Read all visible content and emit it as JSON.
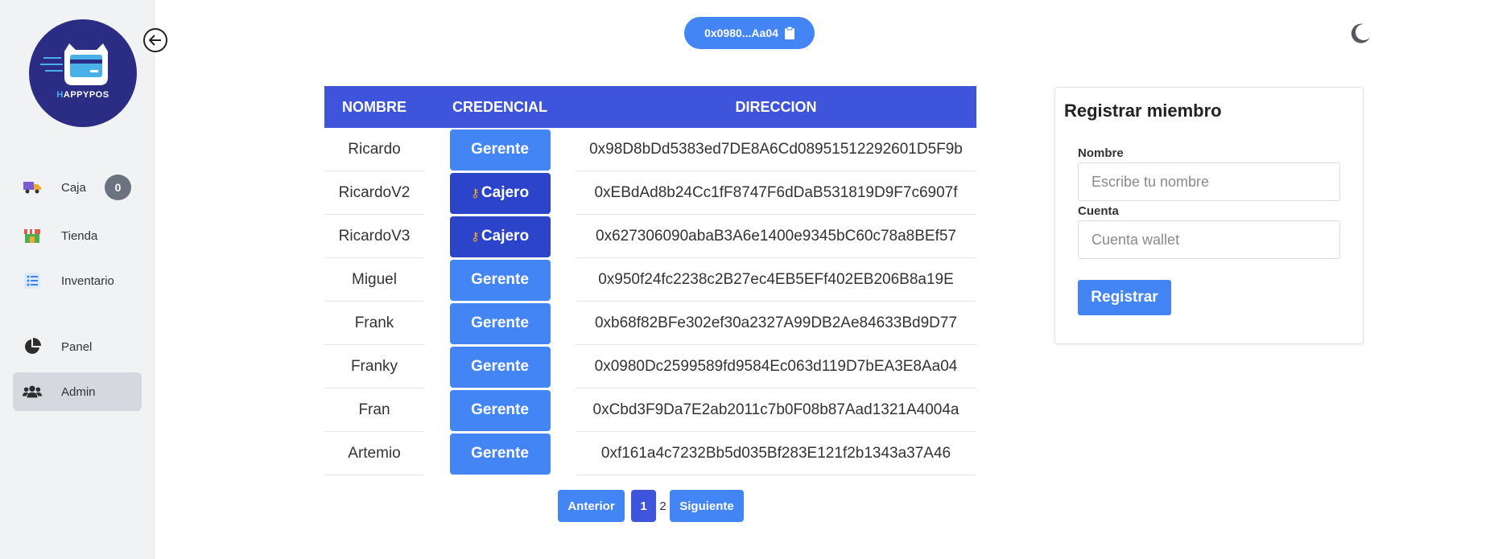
{
  "app": {
    "logo_prefix": "H",
    "logo_suffix": "APPYPOS"
  },
  "sidebar": {
    "items": [
      {
        "label": "Caja",
        "icon": "delivery-truck-icon",
        "badge": "0"
      },
      {
        "label": "Tienda",
        "icon": "store-icon"
      },
      {
        "label": "Inventario",
        "icon": "list-icon"
      },
      {
        "label": "Panel",
        "icon": "pie-chart-icon"
      },
      {
        "label": "Admin",
        "icon": "users-icon",
        "active": true
      }
    ]
  },
  "header": {
    "wallet": "0x0980...Aa04",
    "wallet_icon": "clipboard-icon",
    "theme_icon": "moon-icon"
  },
  "table": {
    "headers": [
      "NOMBRE",
      "CREDENCIAL",
      "DIRECCION"
    ],
    "rows": [
      {
        "nombre": "Ricardo",
        "credencial": "Gerente",
        "direccion": "0x98D8bDd5383ed7DE8A6Cd08951512292601D5F9b"
      },
      {
        "nombre": "RicardoV2",
        "credencial": "Cajero",
        "direccion": "0xEBdAd8b24Cc1fF8747F6dDaB531819D9F7c6907f"
      },
      {
        "nombre": "RicardoV3",
        "credencial": "Cajero",
        "direccion": "0x627306090abaB3A6e1400e9345bC60c78a8BEf57"
      },
      {
        "nombre": "Miguel",
        "credencial": "Gerente",
        "direccion": "0x950f24fc2238c2B27ec4EB5EFf402EB206B8a19E"
      },
      {
        "nombre": "Frank",
        "credencial": "Gerente",
        "direccion": "0xb68f82BFe302ef30a2327A99DB2Ae84633Bd9D77"
      },
      {
        "nombre": "Franky",
        "credencial": "Gerente",
        "direccion": "0x0980Dc2599589fd9584Ec063d119D7bEA3E8Aa04"
      },
      {
        "nombre": "Fran",
        "credencial": "Gerente",
        "direccion": "0xCbd3F9Da7E2ab2011c7b0F08b87Aad1321A4004a"
      },
      {
        "nombre": "Artemio",
        "credencial": "Gerente",
        "direccion": "0xf161a4c7232Bb5d035Bf283E121f2b1343a37A46"
      }
    ]
  },
  "pagination": {
    "prev": "Anterior",
    "current": "1",
    "page2": "2",
    "next": "Siguiente"
  },
  "form": {
    "title": "Registrar miembro",
    "name_label": "Nombre",
    "name_placeholder": "Escribe tu nombre",
    "account_label": "Cuenta",
    "account_placeholder": "Cuenta wallet",
    "submit": "Registrar"
  },
  "colors": {
    "primary": "#4385f5",
    "header": "#3e55db",
    "cajero": "#2b44c9",
    "logo_bg": "#2b2d85"
  }
}
